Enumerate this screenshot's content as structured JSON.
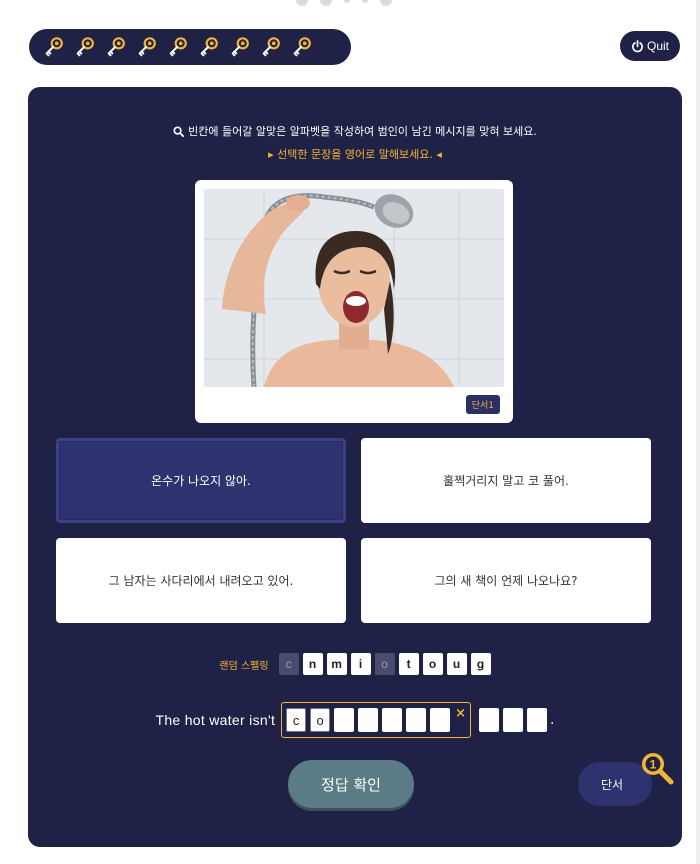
{
  "progress": {
    "keys_count": 9
  },
  "header": {
    "quit_label": "Quit"
  },
  "instructions": {
    "main": "빈칸에 들어갈 알맞은 알파벳을 작성하여 범인이 남긴 메시지를 맞혀 보세요.",
    "sub": "▸ 선택한 문장을 영어로 말해보세요. ◂"
  },
  "photo": {
    "badge": "단서1"
  },
  "options": [
    {
      "text": "온수가 나오지 않아.",
      "selected": true
    },
    {
      "text": "훌쩍거리지 말고 코 풀어.",
      "selected": false
    },
    {
      "text": "그 남자는 사다리에서 내려오고 있어.",
      "selected": false
    },
    {
      "text": "그의 새 책이 언제 나오나요?",
      "selected": false
    }
  ],
  "spelling": {
    "label": "랜덤 스펠링",
    "letters": [
      {
        "ch": "c",
        "used": true
      },
      {
        "ch": "n",
        "used": false
      },
      {
        "ch": "m",
        "used": false
      },
      {
        "ch": "i",
        "used": false
      },
      {
        "ch": "o",
        "used": true
      },
      {
        "ch": "t",
        "used": false
      },
      {
        "ch": "o",
        "used": false
      },
      {
        "ch": "u",
        "used": false
      },
      {
        "ch": "g",
        "used": false
      }
    ]
  },
  "sentence": {
    "prefix": "The hot water isn't",
    "blank_slots": [
      "c",
      "o",
      "",
      "",
      "",
      "",
      ""
    ],
    "clear_mark": "×",
    "trailing_slots": [
      "",
      "",
      ""
    ],
    "period": "."
  },
  "actions": {
    "check_label": "정답 확인",
    "clue_label": "단서",
    "clue_count": "1"
  },
  "colors": {
    "panel": "#1f2146",
    "accent": "#f2b632",
    "selected_option": "#2e3370",
    "check_button": "#5b7b87"
  }
}
